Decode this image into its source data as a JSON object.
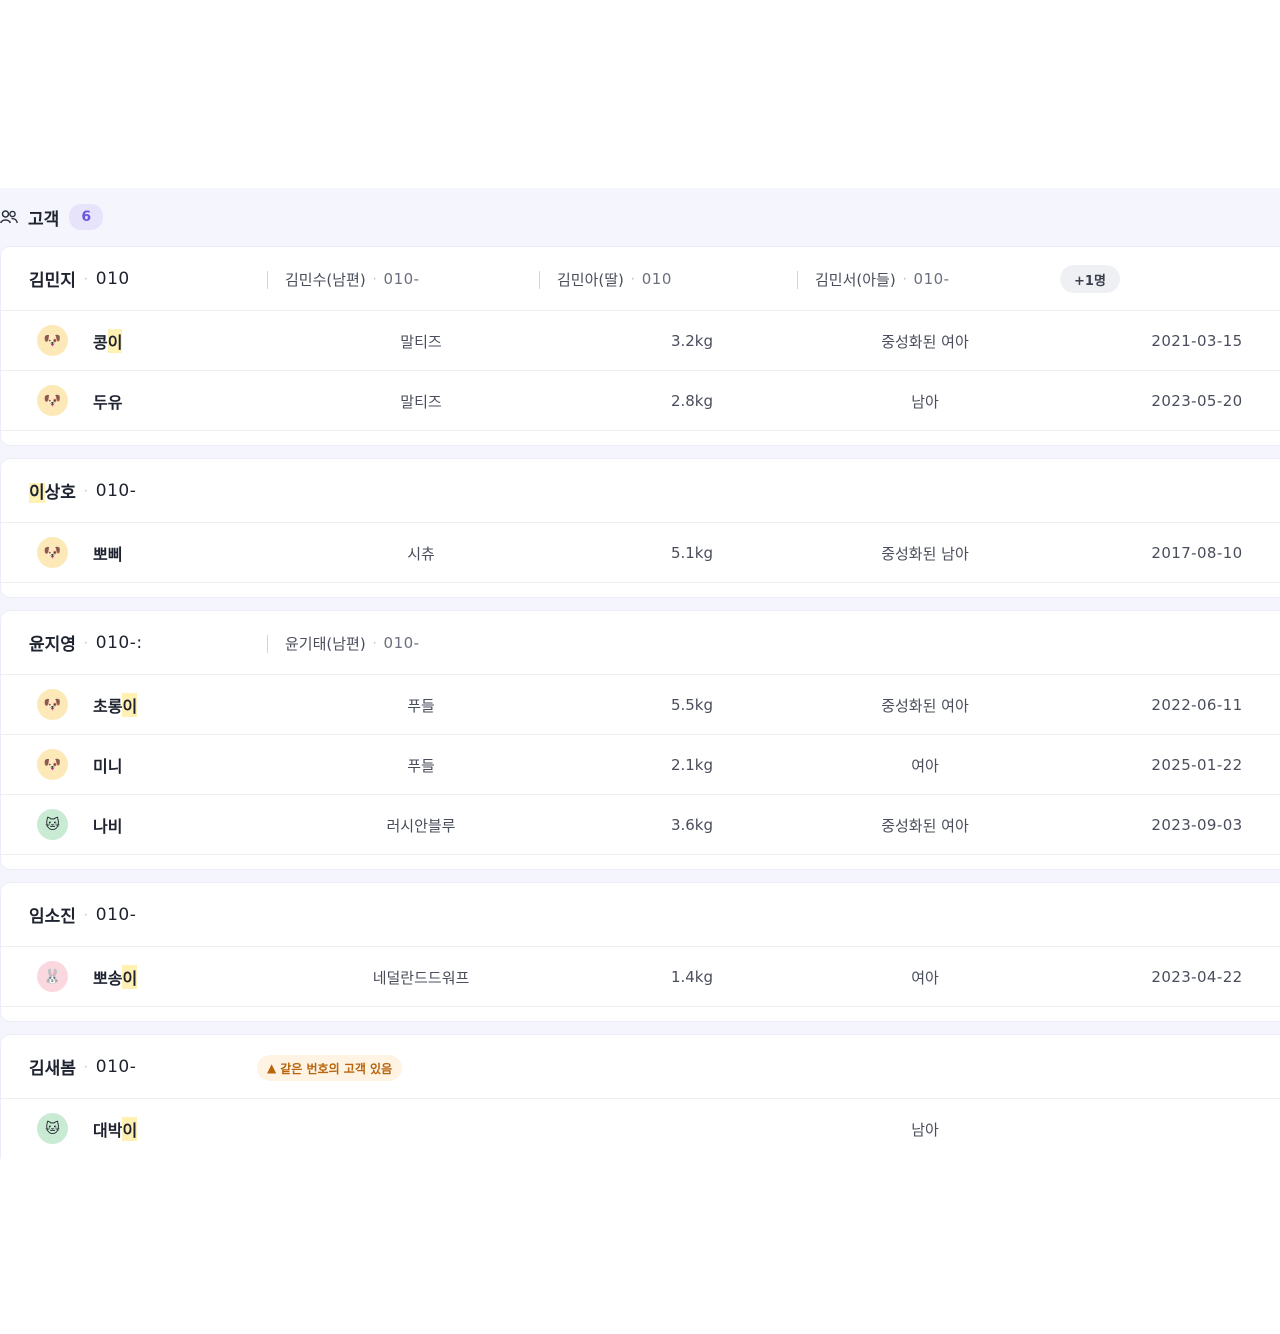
{
  "section": {
    "title": "고객",
    "count": "6",
    "icon": "people-icon"
  },
  "colors": {
    "accent": "#6a55e0",
    "highlight": "#fff0b3",
    "warning": "#b8650c"
  },
  "customers": [
    {
      "owner": {
        "name_pre": "김민지",
        "name_hl": "",
        "name_post": "",
        "phone": "010"
      },
      "family": [
        {
          "name": "김민수(남편)",
          "phone": "010-"
        },
        {
          "name": "김민아(딸)",
          "phone": "010"
        },
        {
          "name": "김민서(아들)",
          "phone": "010-"
        }
      ],
      "more": "+1명",
      "pets": [
        {
          "icon": "dog-icon",
          "name_pre": "콩",
          "name_hl": "이",
          "breed": "말티즈",
          "weight": "3.2kg",
          "sex": "중성화된 여아",
          "date": "2021-03-15"
        },
        {
          "icon": "dog-icon",
          "name_pre": "두유",
          "name_hl": "",
          "breed": "말티즈",
          "weight": "2.8kg",
          "sex": "남아",
          "date": "2023-05-20"
        }
      ]
    },
    {
      "owner": {
        "name_pre": "",
        "name_hl": "이",
        "name_post": "상호",
        "phone": "010-"
      },
      "pets": [
        {
          "icon": "dog-icon",
          "name_pre": "뽀삐",
          "name_hl": "",
          "breed": "시츄",
          "weight": "5.1kg",
          "sex": "중성화된 남아",
          "date": "2017-08-10"
        }
      ]
    },
    {
      "owner": {
        "name_pre": "윤지영",
        "name_hl": "",
        "name_post": "",
        "phone": "010-:"
      },
      "family": [
        {
          "name": "윤기태(남편)",
          "phone": "010-"
        }
      ],
      "pets": [
        {
          "icon": "dog-icon",
          "name_pre": "초롱",
          "name_hl": "이",
          "breed": "푸들",
          "weight": "5.5kg",
          "sex": "중성화된 여아",
          "date": "2022-06-11"
        },
        {
          "icon": "dog-icon",
          "name_pre": "미니",
          "name_hl": "",
          "breed": "푸들",
          "weight": "2.1kg",
          "sex": "여아",
          "date": "2025-01-22"
        },
        {
          "icon": "cat-icon",
          "name_pre": "나비",
          "name_hl": "",
          "breed": "러시안블루",
          "weight": "3.6kg",
          "sex": "중성화된 여아",
          "date": "2023-09-03"
        }
      ]
    },
    {
      "owner": {
        "name_pre": "임소진",
        "name_hl": "",
        "name_post": "",
        "phone": "010-"
      },
      "pets": [
        {
          "icon": "rabbit-icon",
          "name_pre": "뽀송",
          "name_hl": "이",
          "breed": "네덜란드드워프",
          "weight": "1.4kg",
          "sex": "여아",
          "date": "2023-04-22"
        }
      ]
    },
    {
      "owner": {
        "name_pre": "김새봄",
        "name_hl": "",
        "name_post": "",
        "phone": "010-"
      },
      "warning": "같은 번호의 고객 있음",
      "pets": [
        {
          "icon": "cat-icon",
          "name_pre": "대박",
          "name_hl": "이",
          "breed": "",
          "weight": "",
          "sex": "남아",
          "date": ""
        }
      ]
    }
  ]
}
